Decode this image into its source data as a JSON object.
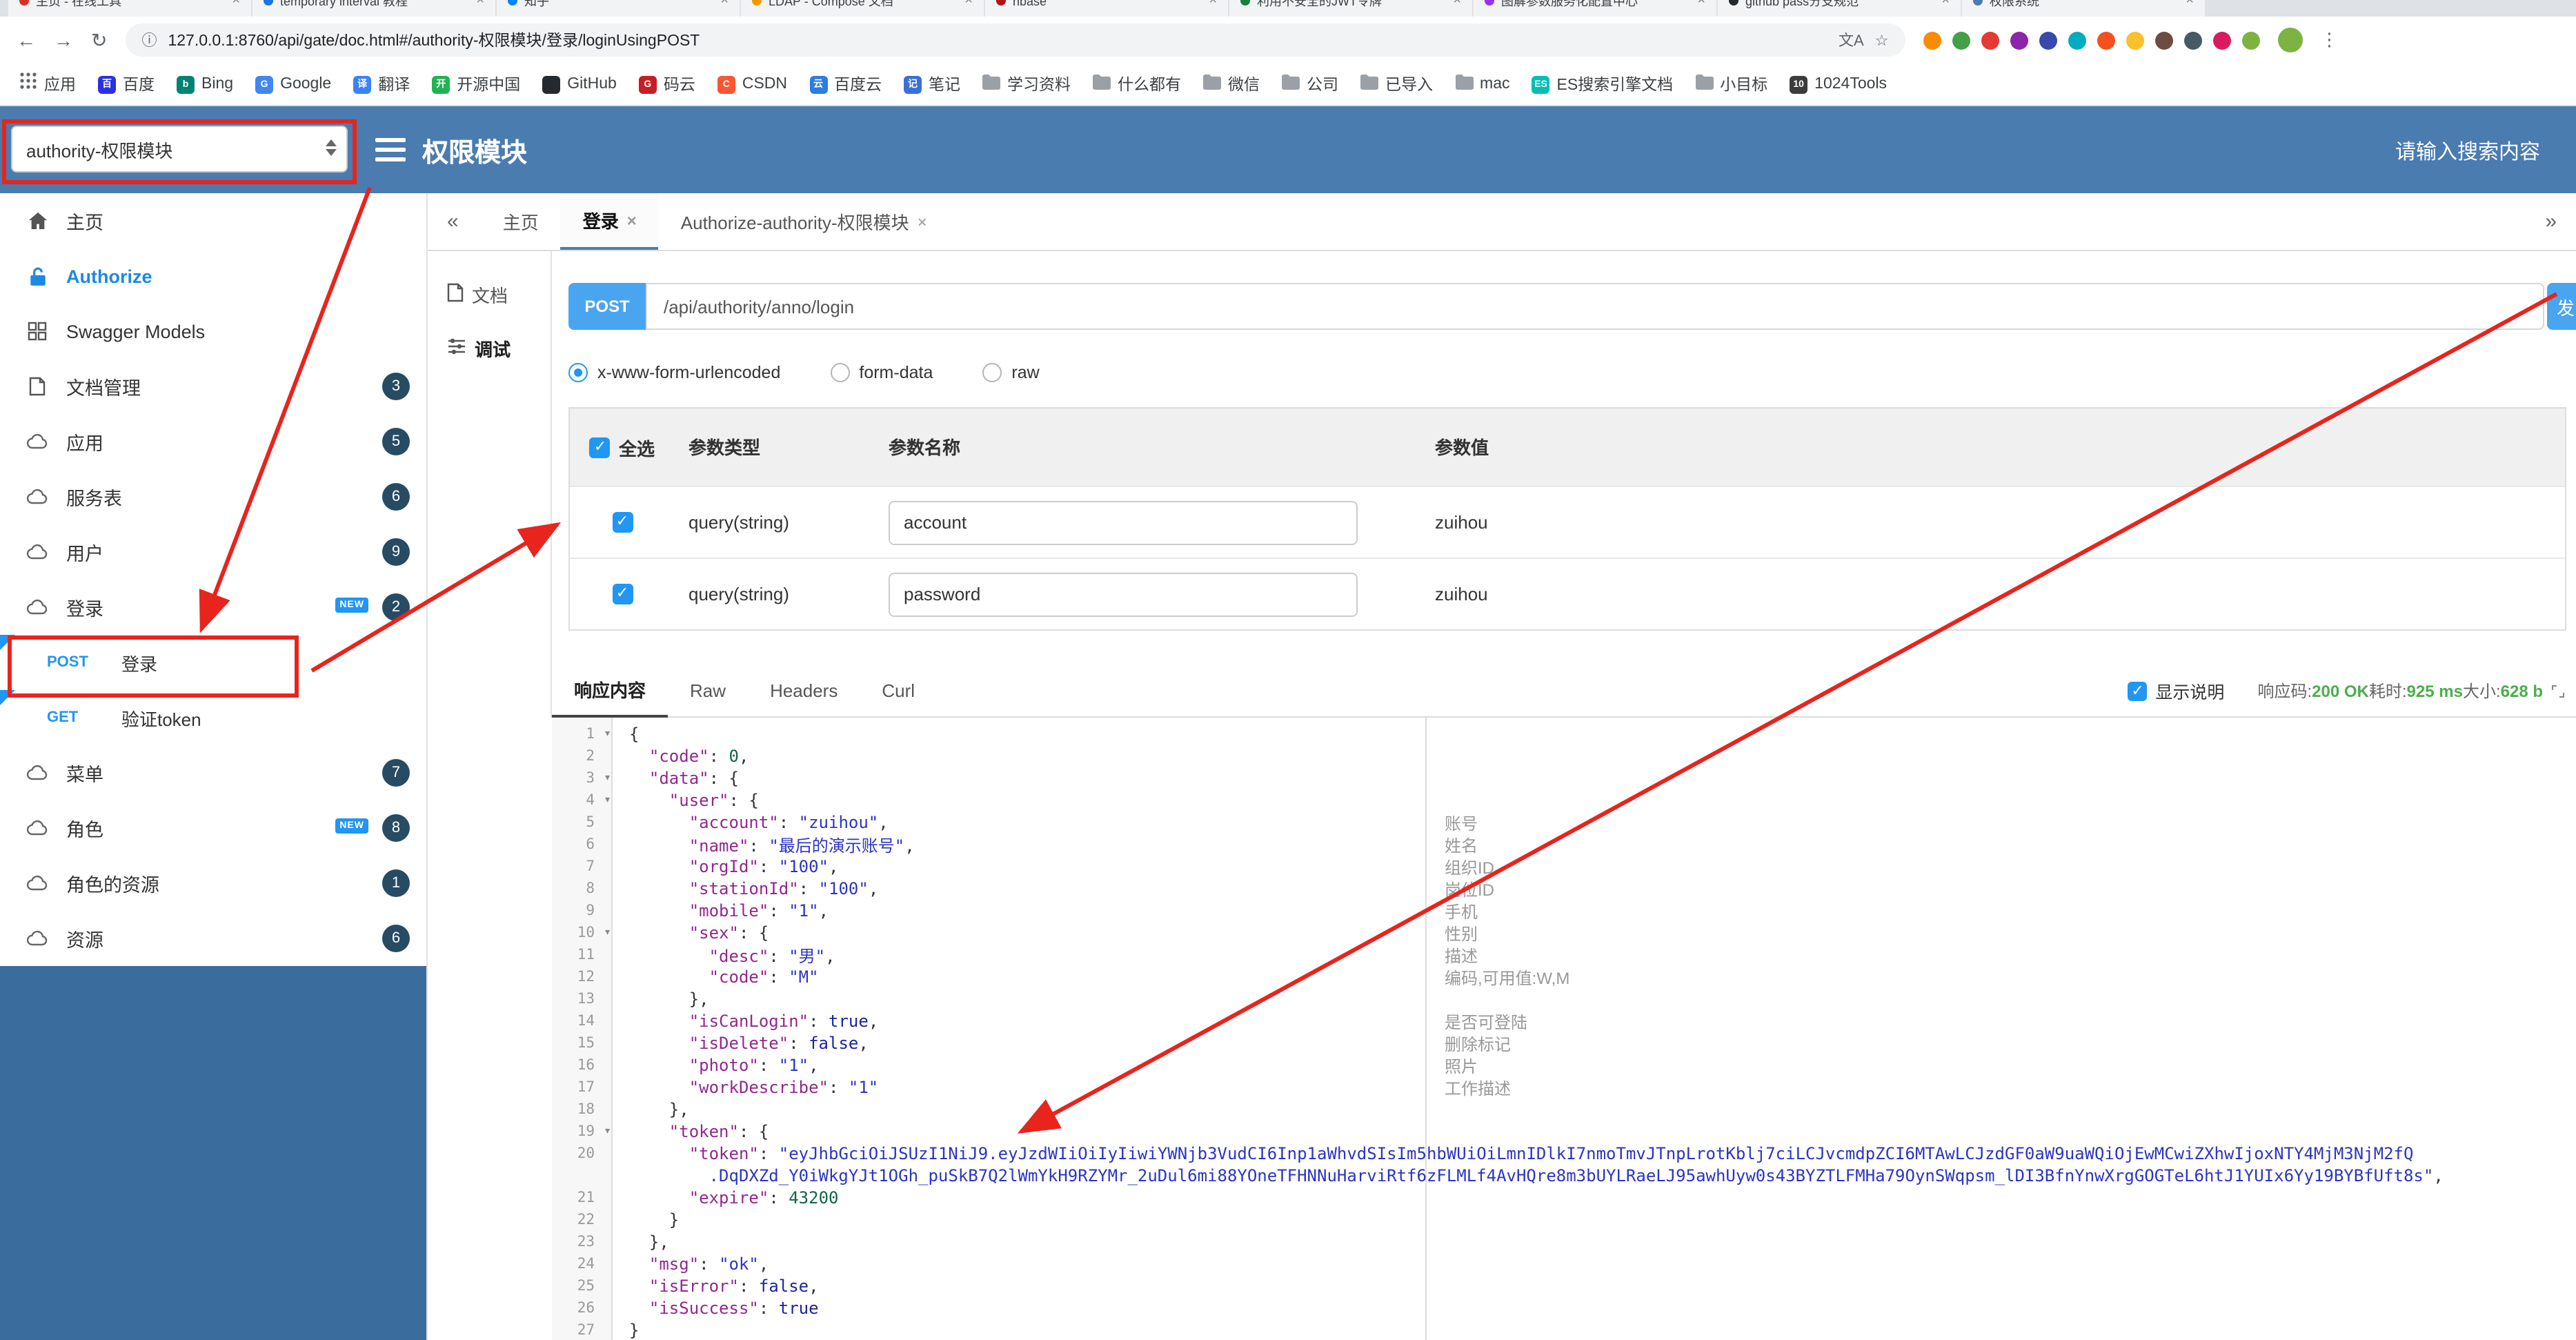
{
  "colors": {
    "header_blue": "#4a7cb0",
    "accent_blue": "#1e88e5",
    "method_blue": "#4aa5f0",
    "annotation_red": "#e8241d",
    "success_green": "#4cae4c",
    "sidebar_fill": "#3a6d9e"
  },
  "browser": {
    "tabs": [
      {
        "title": "主页 - 在线工具",
        "fav": "#d93025"
      },
      {
        "title": "temporary interval 教程",
        "fav": "#1a73e8"
      },
      {
        "title": "知乎",
        "fav": "#0084ff"
      },
      {
        "title": "LDAP - Compose 文档",
        "fav": "#f29900"
      },
      {
        "title": "hbase",
        "fav": "#b31412"
      },
      {
        "title": "利用不安全的JWT令牌",
        "fav": "#188038"
      },
      {
        "title": "图解参数服务化配置中心",
        "fav": "#9334e6"
      },
      {
        "title": "github pass分支规范",
        "fav": "#24292e"
      },
      {
        "title": "权限系统",
        "fav": "#4a7cb0"
      }
    ],
    "url": "127.0.0.1:8760/api/gate/doc.html#/authority-权限模块/登录/loginUsingPOST",
    "ext_icon_colors": [
      "#fb8c00",
      "#43a047",
      "#e53935",
      "#8e24aa",
      "#3949ab",
      "#00acc1",
      "#f4511e",
      "#fbc02d",
      "#6d4c41",
      "#455a64",
      "#d81b60",
      "#7cb342"
    ],
    "bookmarks": [
      {
        "label": "应用",
        "icon": "apps"
      },
      {
        "label": "百度",
        "icon": "dot",
        "color": "#2932e1",
        "letter": "百"
      },
      {
        "label": "Bing",
        "icon": "dot",
        "color": "#008373",
        "letter": "b"
      },
      {
        "label": "Google",
        "icon": "dot",
        "color": "#4285f4",
        "letter": "G"
      },
      {
        "label": "翻译",
        "icon": "dot",
        "color": "#3b82f6",
        "letter": "译"
      },
      {
        "label": "开源中国",
        "icon": "dot",
        "color": "#21b351",
        "letter": "开"
      },
      {
        "label": "GitHub",
        "icon": "dot",
        "color": "#24292e",
        "letter": ""
      },
      {
        "label": "码云",
        "icon": "dot",
        "color": "#c71d23",
        "letter": "G"
      },
      {
        "label": "CSDN",
        "icon": "dot",
        "color": "#fc5531",
        "letter": "C"
      },
      {
        "label": "百度云",
        "icon": "dot",
        "color": "#2b7de1",
        "letter": "云"
      },
      {
        "label": "笔记",
        "icon": "dot",
        "color": "#3a6fd8",
        "letter": "记"
      },
      {
        "label": "学习资料",
        "icon": "folder"
      },
      {
        "label": "什么都有",
        "icon": "folder"
      },
      {
        "label": "微信",
        "icon": "folder"
      },
      {
        "label": "公司",
        "icon": "folder"
      },
      {
        "label": "已导入",
        "icon": "folder"
      },
      {
        "label": "mac",
        "icon": "folder"
      },
      {
        "label": "ES搜索引擎文档",
        "icon": "dot",
        "color": "#00bfb3",
        "letter": "ES"
      },
      {
        "label": "小目标",
        "icon": "folder"
      },
      {
        "label": "1024Tools",
        "icon": "dot",
        "color": "#3c3c3c",
        "letter": "10"
      }
    ]
  },
  "header": {
    "module_select": "authority-权限模块",
    "title": "权限模块",
    "search_placeholder": "请输入搜索内容"
  },
  "sidebar": {
    "new_label": "NEW",
    "items": [
      {
        "label": "主页",
        "icon": "home"
      },
      {
        "label": "Authorize",
        "icon": "lock",
        "accent": true
      },
      {
        "label": "Swagger Models",
        "icon": "grid"
      },
      {
        "label": "文档管理",
        "icon": "doc",
        "badge": "3"
      },
      {
        "label": "应用",
        "icon": "cloud",
        "badge": "5"
      },
      {
        "label": "服务表",
        "icon": "cloud",
        "badge": "6"
      },
      {
        "label": "用户",
        "icon": "cloud",
        "badge": "9"
      },
      {
        "label": "登录",
        "icon": "cloud",
        "badge": "2",
        "new": true,
        "children": [
          {
            "method": "POST",
            "label": "登录"
          },
          {
            "method": "GET",
            "label": "验证token"
          }
        ]
      },
      {
        "label": "菜单",
        "icon": "cloud",
        "badge": "7"
      },
      {
        "label": "角色",
        "icon": "cloud",
        "badge": "8",
        "new": true
      },
      {
        "label": "角色的资源",
        "icon": "cloud",
        "badge": "1"
      },
      {
        "label": "资源",
        "icon": "cloud",
        "badge": "6"
      }
    ]
  },
  "tabs": {
    "collapse": "«",
    "expand": "»",
    "items": [
      {
        "label": "主页",
        "closable": false,
        "active": false
      },
      {
        "label": "登录",
        "closable": true,
        "active": true
      },
      {
        "label": "Authorize-authority-权限模块",
        "closable": true,
        "active": false
      }
    ]
  },
  "doc_tabs": [
    {
      "label": "文档",
      "icon": "doc",
      "active": false
    },
    {
      "label": "调试",
      "icon": "debug",
      "active": true
    }
  ],
  "request": {
    "method": "POST",
    "url": "/api/authority/anno/login",
    "send_label": "发",
    "content_types": [
      {
        "label": "x-www-form-urlencoded",
        "selected": true
      },
      {
        "label": "form-data",
        "selected": false
      },
      {
        "label": "raw",
        "selected": false
      }
    ],
    "table": {
      "headers": [
        "全选",
        "参数类型",
        "参数名称",
        "参数值"
      ],
      "rows": [
        {
          "checked": true,
          "type": "query(string)",
          "name": "account",
          "value": "zuihou"
        },
        {
          "checked": true,
          "type": "query(string)",
          "name": "password",
          "value": "zuihou"
        }
      ]
    }
  },
  "response": {
    "tabs": [
      {
        "label": "响应内容",
        "active": true
      },
      {
        "label": "Raw",
        "active": false
      },
      {
        "label": "Headers",
        "active": false
      },
      {
        "label": "Curl",
        "active": false
      }
    ],
    "show_desc_label": "显示说明",
    "show_desc_checked": true,
    "meta_parts": [
      [
        "m",
        "响应码:"
      ],
      [
        "g",
        "200 OK"
      ],
      [
        "m",
        "耗时:"
      ],
      [
        "g",
        "925 ms"
      ],
      [
        "m",
        "大小:"
      ],
      [
        "g",
        "628 b"
      ]
    ]
  },
  "editor": {
    "lines": [
      {
        "n": "1",
        "fold": true,
        "seg": [
          [
            "p",
            "{"
          ]
        ]
      },
      {
        "n": "2",
        "seg": [
          [
            "k",
            "  \"code\""
          ],
          [
            "p",
            ": "
          ],
          [
            "num",
            "0"
          ],
          [
            "p",
            ","
          ]
        ]
      },
      {
        "n": "3",
        "fold": true,
        "seg": [
          [
            "k",
            "  \"data\""
          ],
          [
            "p",
            ": {"
          ]
        ]
      },
      {
        "n": "4",
        "fold": true,
        "seg": [
          [
            "k",
            "    \"user\""
          ],
          [
            "p",
            ": {"
          ]
        ]
      },
      {
        "n": "5",
        "seg": [
          [
            "k",
            "      \"account\""
          ],
          [
            "p",
            ": "
          ],
          [
            "s",
            "\"zuihou\""
          ],
          [
            "p",
            ","
          ]
        ]
      },
      {
        "n": "6",
        "seg": [
          [
            "k",
            "      \"name\""
          ],
          [
            "p",
            ": "
          ],
          [
            "s",
            "\"最后的演示账号\""
          ],
          [
            "p",
            ","
          ]
        ]
      },
      {
        "n": "7",
        "seg": [
          [
            "k",
            "      \"orgId\""
          ],
          [
            "p",
            ": "
          ],
          [
            "s",
            "\"100\""
          ],
          [
            "p",
            ","
          ]
        ]
      },
      {
        "n": "8",
        "seg": [
          [
            "k",
            "      \"stationId\""
          ],
          [
            "p",
            ": "
          ],
          [
            "s",
            "\"100\""
          ],
          [
            "p",
            ","
          ]
        ]
      },
      {
        "n": "9",
        "seg": [
          [
            "k",
            "      \"mobile\""
          ],
          [
            "p",
            ": "
          ],
          [
            "s",
            "\"1\""
          ],
          [
            "p",
            ","
          ]
        ]
      },
      {
        "n": "10",
        "fold": true,
        "seg": [
          [
            "k",
            "      \"sex\""
          ],
          [
            "p",
            ": {"
          ]
        ]
      },
      {
        "n": "11",
        "seg": [
          [
            "k",
            "        \"desc\""
          ],
          [
            "p",
            ": "
          ],
          [
            "s",
            "\"男\""
          ],
          [
            "p",
            ","
          ]
        ]
      },
      {
        "n": "12",
        "seg": [
          [
            "k",
            "        \"code\""
          ],
          [
            "p",
            ": "
          ],
          [
            "s",
            "\"M\""
          ]
        ]
      },
      {
        "n": "13",
        "seg": [
          [
            "p",
            "      },"
          ]
        ]
      },
      {
        "n": "14",
        "seg": [
          [
            "k",
            "      \"isCanLogin\""
          ],
          [
            "p",
            ": "
          ],
          [
            "b",
            "true"
          ],
          [
            "p",
            ","
          ]
        ]
      },
      {
        "n": "15",
        "seg": [
          [
            "k",
            "      \"isDelete\""
          ],
          [
            "p",
            ": "
          ],
          [
            "b",
            "false"
          ],
          [
            "p",
            ","
          ]
        ]
      },
      {
        "n": "16",
        "seg": [
          [
            "k",
            "      \"photo\""
          ],
          [
            "p",
            ": "
          ],
          [
            "s",
            "\"1\""
          ],
          [
            "p",
            ","
          ]
        ]
      },
      {
        "n": "17",
        "seg": [
          [
            "k",
            "      \"workDescribe\""
          ],
          [
            "p",
            ": "
          ],
          [
            "s",
            "\"1\""
          ]
        ]
      },
      {
        "n": "18",
        "seg": [
          [
            "p",
            "    },"
          ]
        ]
      },
      {
        "n": "19",
        "fold": true,
        "seg": [
          [
            "k",
            "    \"token\""
          ],
          [
            "p",
            ": {"
          ]
        ]
      },
      {
        "n": "20",
        "seg": [
          [
            "k",
            "      \"token\""
          ],
          [
            "p",
            ": "
          ],
          [
            "s",
            "\"eyJhbGciOiJSUzI1NiJ9.eyJzdWIiOiIyIiwiYWNjb3VudCI6Inp1aWhvdSIsIm5hbWUiOiLmnIDlkI7nmoTmvJTnpLrotKblj7ciLCJvcmdpZCI6MTAwLCJzdGF0aW9uaWQiOjEwMCwiZXhwIjoxNTY4MjM3NjM2fQ"
          ]
        ]
      },
      {
        "n": "",
        "seg": [
          [
            "s",
            "        .DqDXZd_Y0iWkgYJt1OGh_puSkB7Q2lWmYkH9RZYMr_2uDul6mi88YOneTFHNNuHarviRtf6zFLMLf4AvHQre8m3bUYLRaeLJ95awhUyw0s43BYZTLFMHa79OynSWqpsm_lDI3BfnYnwXrgGOGTeL6htJ1YUIx6Yy19BYBfUft8s\""
          ],
          [
            "p",
            ","
          ]
        ]
      },
      {
        "n": "21",
        "seg": [
          [
            "k",
            "      \"expire\""
          ],
          [
            "p",
            ": "
          ],
          [
            "num",
            "43200"
          ]
        ]
      },
      {
        "n": "22",
        "seg": [
          [
            "p",
            "    }"
          ]
        ]
      },
      {
        "n": "23",
        "seg": [
          [
            "p",
            "  },"
          ]
        ]
      },
      {
        "n": "24",
        "seg": [
          [
            "k",
            "  \"msg\""
          ],
          [
            "p",
            ": "
          ],
          [
            "s",
            "\"ok\""
          ],
          [
            "p",
            ","
          ]
        ]
      },
      {
        "n": "25",
        "seg": [
          [
            "k",
            "  \"isError\""
          ],
          [
            "p",
            ": "
          ],
          [
            "b",
            "false"
          ],
          [
            "p",
            ","
          ]
        ]
      },
      {
        "n": "26",
        "seg": [
          [
            "k",
            "  \"isSuccess\""
          ],
          [
            "p",
            ": "
          ],
          [
            "b",
            "true"
          ]
        ]
      },
      {
        "n": "27",
        "seg": [
          [
            "p",
            "}"
          ]
        ]
      }
    ],
    "annotations": [
      {
        "line": 5,
        "text": "账号"
      },
      {
        "line": 6,
        "text": "姓名"
      },
      {
        "line": 7,
        "text": "组织ID"
      },
      {
        "line": 8,
        "text": "岗位ID"
      },
      {
        "line": 9,
        "text": "手机"
      },
      {
        "line": 10,
        "text": "性别"
      },
      {
        "line": 11,
        "text": "描述"
      },
      {
        "line": 12,
        "text": "编码,可用值:W,M"
      },
      {
        "line": 14,
        "text": "是否可登陆"
      },
      {
        "line": 15,
        "text": "删除标记"
      },
      {
        "line": 16,
        "text": "照片"
      },
      {
        "line": 17,
        "text": "工作描述"
      }
    ]
  }
}
